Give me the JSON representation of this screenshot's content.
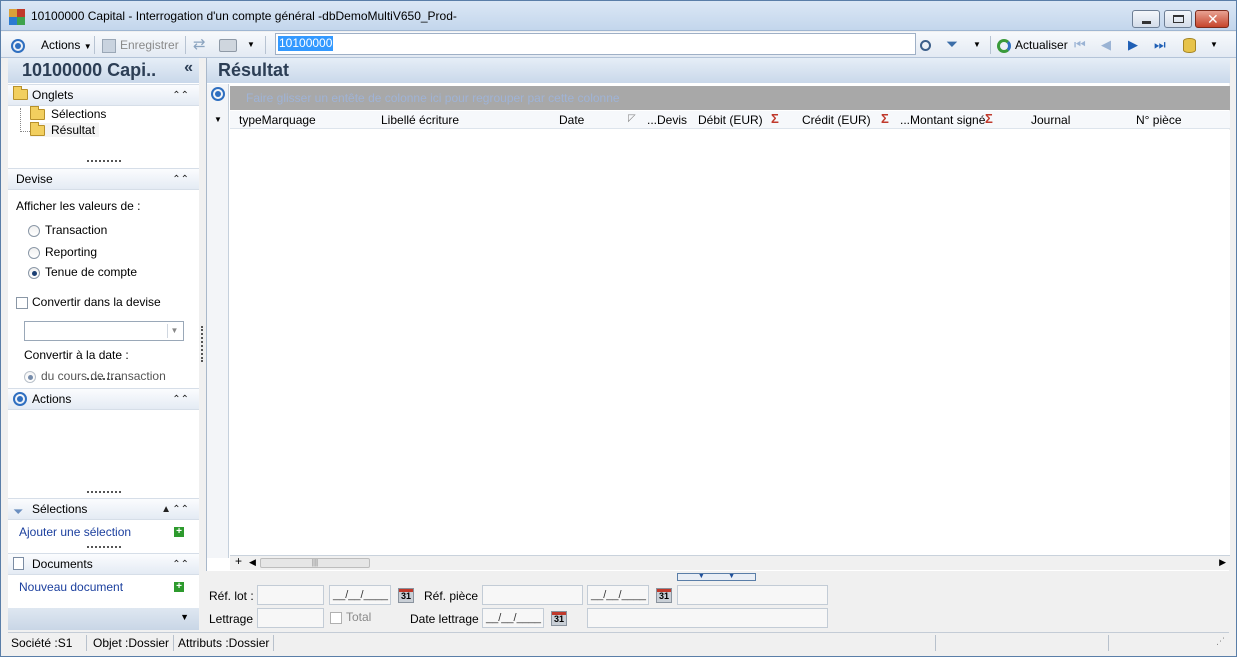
{
  "window": {
    "title": "10100000 Capital -  Interrogation d'un compte général -dbDemoMultiV650_Prod-"
  },
  "toolbar": {
    "actions_label": "Actions",
    "save_label": "Enregistrer",
    "search_value": "10100000",
    "refresh_label": "Actualiser"
  },
  "left_panel": {
    "header": "10100000 Capi..",
    "collapse_glyph": "«",
    "onglets": {
      "title": "Onglets",
      "items": [
        "Sélections",
        "Résultat"
      ]
    },
    "devise": {
      "title": "Devise",
      "show_values_label": "Afficher les valeurs de :",
      "options": [
        {
          "label": "Transaction",
          "selected": false
        },
        {
          "label": "Reporting",
          "selected": false
        },
        {
          "label": "Tenue de compte",
          "selected": true
        }
      ],
      "convert_checkbox_label": "Convertir dans la devise",
      "convert_date_label": "Convertir à la date :",
      "date_option_label": "du cours de transaction"
    },
    "actions": {
      "title": "Actions"
    },
    "selections": {
      "title": "Sélections",
      "add_link": "Ajouter une sélection"
    },
    "documents": {
      "title": "Documents",
      "new_link": "Nouveau document"
    }
  },
  "content": {
    "title": "Résultat",
    "group_bar_text": "Faire glisser un entête de colonne ici pour regrouper par cette colonne",
    "columns": [
      "typeMarquage",
      "Libellé écriture",
      "Date",
      "...Devis",
      "Débit (EUR)",
      "Crédit (EUR)",
      "...Montant signé",
      "Journal",
      "N° pièce"
    ]
  },
  "filters": {
    "ref_lot_label": "Réf. lot :",
    "ref_piece_label": "Réf. pièce :",
    "lettrage_label": "Lettrage :",
    "total_label": "Total",
    "date_lettrage_label": "Date lettrage :",
    "date_placeholder": "__/__/____",
    "calendar_text": "31"
  },
  "statusbar": {
    "societe": "Société :S1",
    "objet": "Objet :Dossier",
    "attributs": "Attributs :Dossier"
  },
  "colors": {
    "accent_blue": "#2f6fc0",
    "header_text": "#2c3e55",
    "link_blue": "#1b3f9e",
    "sigma_red": "#c0392b"
  }
}
